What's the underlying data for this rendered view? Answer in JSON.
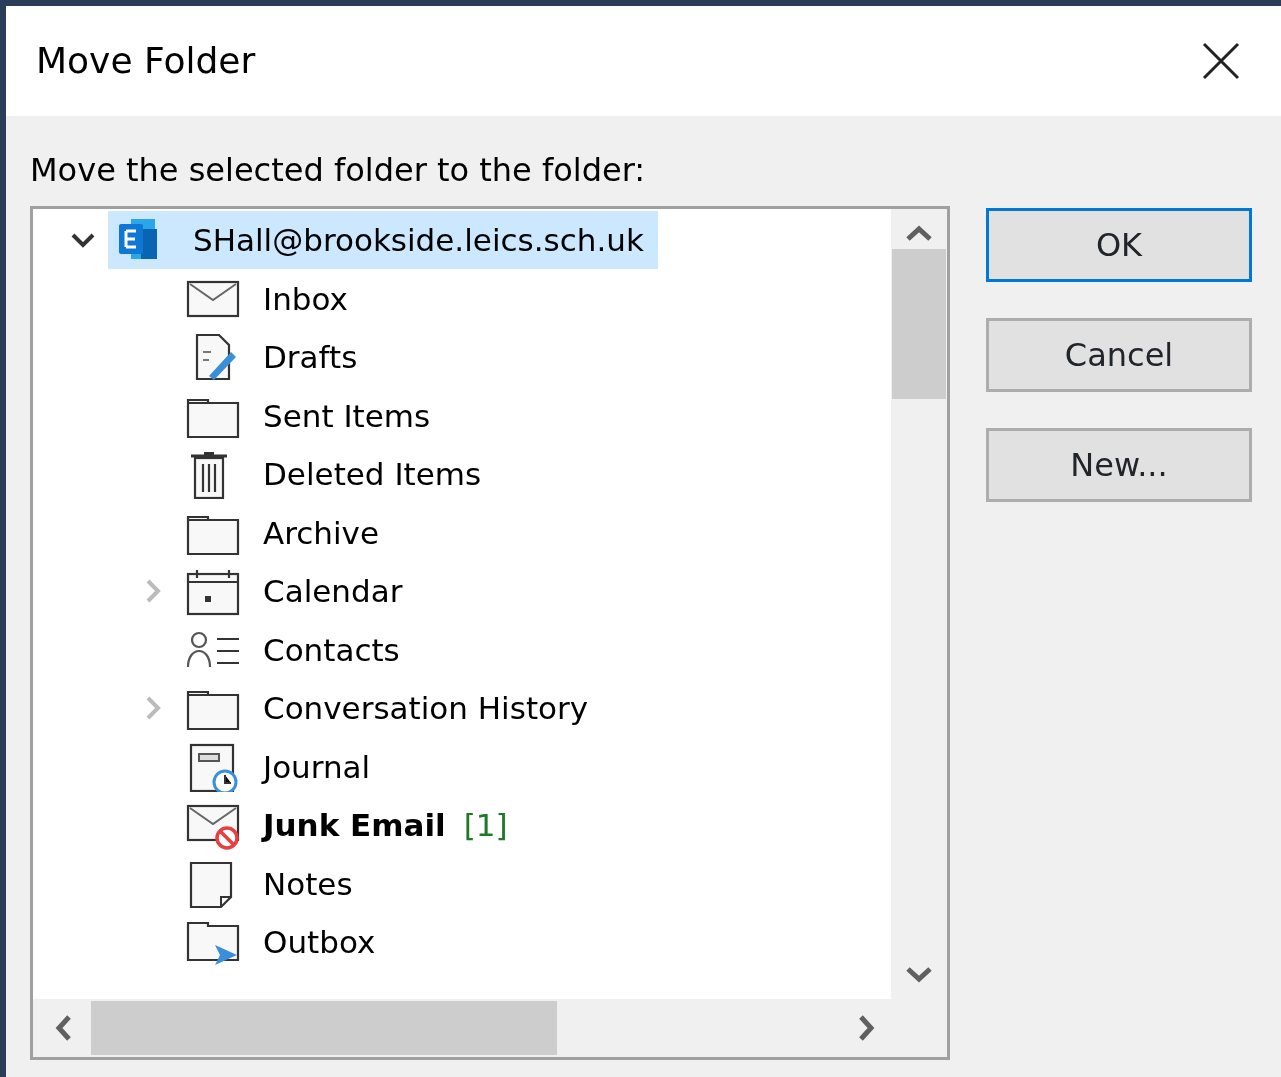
{
  "window": {
    "title": "Move Folder"
  },
  "prompt": "Move the selected folder to the folder:",
  "tree": {
    "label": "SHall@brookside.leics.sch.uk",
    "kind": "account",
    "expanded": true,
    "selected": true,
    "children": [
      {
        "label": "Inbox",
        "kind": "inbox",
        "selected": false,
        "unread": false
      },
      {
        "label": "Drafts",
        "kind": "drafts",
        "selected": false,
        "unread": false
      },
      {
        "label": "Sent Items",
        "kind": "folder",
        "selected": false,
        "unread": false
      },
      {
        "label": "Deleted Items",
        "kind": "trash",
        "selected": false,
        "unread": false
      },
      {
        "label": "Archive",
        "kind": "folder",
        "selected": false,
        "unread": false
      },
      {
        "label": "Calendar",
        "kind": "calendar",
        "expanded": false,
        "selected": false,
        "unread": false
      },
      {
        "label": "Contacts",
        "kind": "contacts",
        "selected": false,
        "unread": false
      },
      {
        "label": "Conversation History",
        "kind": "folder",
        "expanded": false,
        "selected": false,
        "unread": false
      },
      {
        "label": "Journal",
        "kind": "journal",
        "selected": false,
        "unread": false
      },
      {
        "label": "Junk Email",
        "kind": "junk",
        "selected": false,
        "unread": true,
        "count": "[1]"
      },
      {
        "label": "Notes",
        "kind": "notes",
        "selected": false,
        "unread": false
      },
      {
        "label": "Outbox",
        "kind": "outbox",
        "selected": false,
        "unread": false
      }
    ]
  },
  "buttons": [
    {
      "label": "OK",
      "default": true
    },
    {
      "label": "Cancel",
      "default": false
    },
    {
      "label": "New...",
      "default": false
    }
  ]
}
